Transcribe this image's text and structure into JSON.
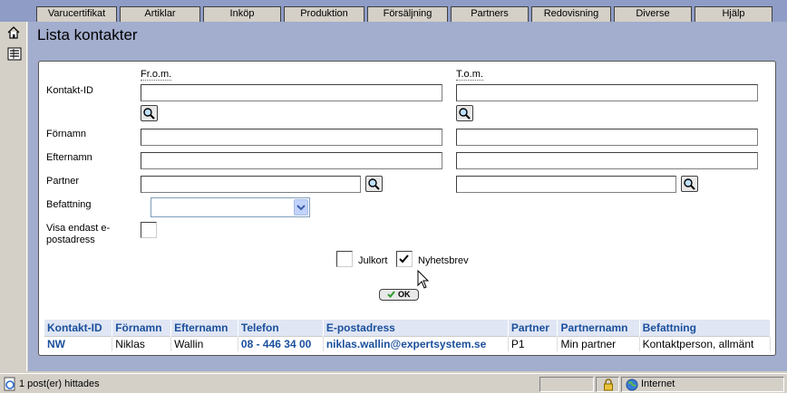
{
  "nav_tabs": [
    {
      "label": "Varucertifikat",
      "name": "tab-varucertifikat"
    },
    {
      "label": "Artiklar",
      "name": "tab-artiklar"
    },
    {
      "label": "Inköp",
      "name": "tab-inkop"
    },
    {
      "label": "Produktion",
      "name": "tab-produktion"
    },
    {
      "label": "Försäljning",
      "name": "tab-forsaljning"
    },
    {
      "label": "Partners",
      "name": "tab-partners"
    },
    {
      "label": "Redovisning",
      "name": "tab-redovisning"
    },
    {
      "label": "Diverse",
      "name": "tab-diverse"
    },
    {
      "label": "Hjälp",
      "name": "tab-hjalp"
    }
  ],
  "page": {
    "title": "Lista kontakter"
  },
  "form": {
    "from_header": "Fr.o.m.",
    "to_header": "T.o.m.",
    "contact_id_label": "Kontakt-ID",
    "firstname_label": "Förnamn",
    "lastname_label": "Efternamn",
    "partner_label": "Partner",
    "position_label": "Befattning",
    "email_only_label": "Visa endast e-postadress",
    "contact_id_from": "",
    "contact_id_to": "",
    "firstname_from": "",
    "firstname_to": "",
    "lastname_from": "",
    "lastname_to": "",
    "partner_from": "",
    "partner_to": "",
    "position_value": "",
    "email_only_checked": false,
    "julkort_label": "Julkort",
    "julkort_checked": false,
    "nyhetsbrev_label": "Nyhetsbrev",
    "nyhetsbrev_checked": true,
    "ok_label": "OK"
  },
  "results": {
    "columns": [
      "Kontakt-ID",
      "Förnamn",
      "Efternamn",
      "Telefon",
      "E-postadress",
      "Partner",
      "Partnernamn",
      "Befattning"
    ],
    "rows": [
      [
        "NW",
        "Niklas",
        "Wallin",
        "08 - 446 34 00",
        "niklas.wallin@expertsystem.se",
        "P1",
        "Min partner",
        "Kontaktperson, allmänt"
      ]
    ]
  },
  "status": {
    "message": "1 post(er) hittades",
    "zone": "Internet"
  },
  "colors": {
    "header_bg": "#8e9cc6",
    "content_bg": "#a3adcd",
    "link": "#1a4f9c",
    "table_header_bg": "#e0e6f4"
  },
  "icons": {
    "home": "home-icon",
    "list": "list-icon",
    "lookup": "magnifier-icon",
    "lock": "lock-icon",
    "globe": "globe-icon",
    "ok": "checkmark-icon"
  }
}
